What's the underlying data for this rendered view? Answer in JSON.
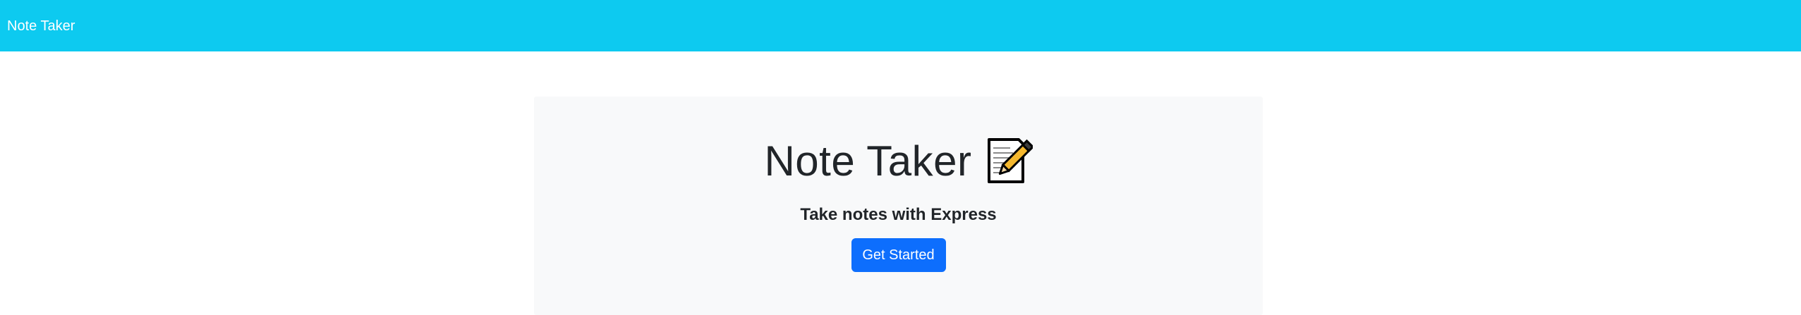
{
  "navbar": {
    "brand": "Note Taker",
    "color": "#0dcaf0"
  },
  "hero": {
    "title": "Note Taker",
    "icon": "memo-icon",
    "subtitle": "Take notes with Express",
    "cta_label": "Get Started",
    "cta_color": "#0d6efd",
    "background": "#f8f9fa"
  }
}
